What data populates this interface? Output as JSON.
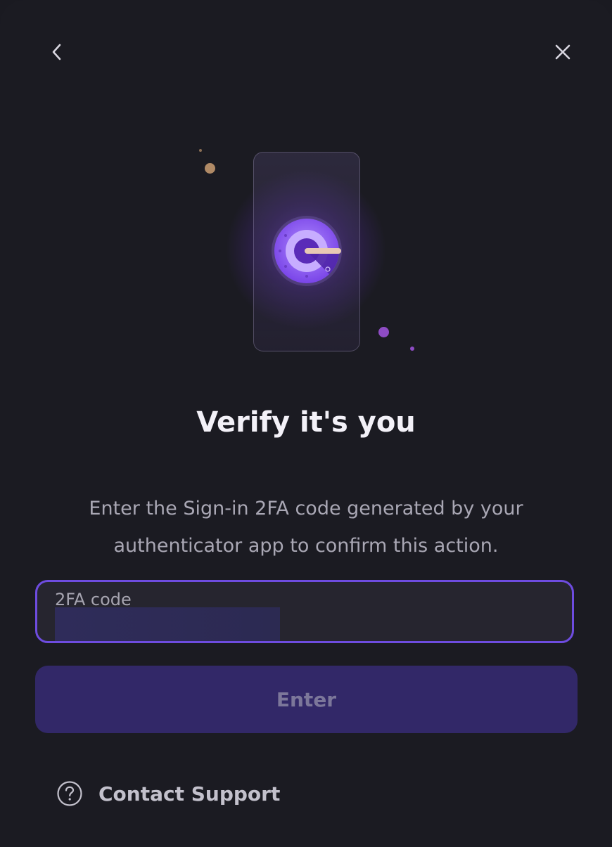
{
  "nav": {
    "back_icon": "chevron-left-icon",
    "close_icon": "close-icon"
  },
  "illustration": {
    "icon": "authenticator-app-icon",
    "accent_color": "#8b5cf6"
  },
  "title": "Verify it's you",
  "description": "Enter the Sign-in 2FA code generated by your authenticator app to confirm this action.",
  "code_field": {
    "label": "2FA code",
    "value": ""
  },
  "submit": {
    "label": "Enter"
  },
  "support": {
    "icon": "help-circle-icon",
    "label": "Contact Support"
  },
  "colors": {
    "background": "#1b1b22",
    "input_border": "#6e4ce0",
    "button_bg": "#322868",
    "button_text": "#7c779a"
  }
}
